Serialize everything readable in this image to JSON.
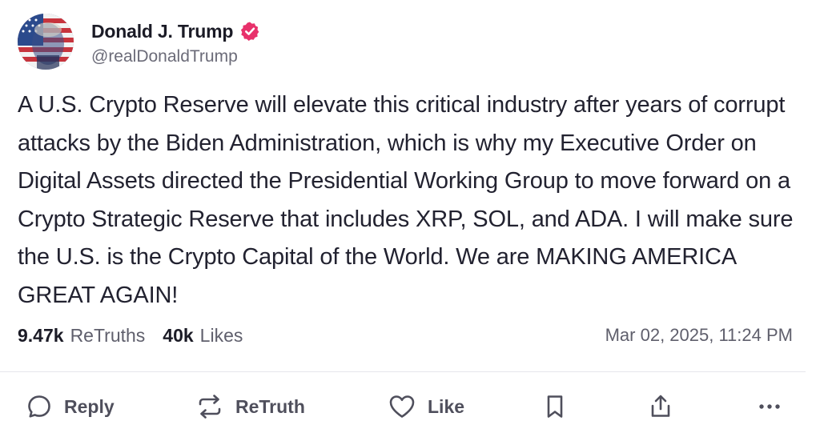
{
  "author": {
    "display_name": "Donald J. Trump",
    "handle": "@realDonaldTrump",
    "verified": true,
    "avatar_icon": "profile-photo-flag"
  },
  "post": {
    "text": "A U.S. Crypto Reserve will elevate this critical industry after years of corrupt attacks by the Biden Administration, which is why my Executive Order on Digital Assets directed the Presidential Working Group to move forward on a Crypto Strategic Reserve that includes XRP, SOL, and ADA. I will make sure the U.S. is the Crypto Capital of the World. We are MAKING AMERICA GREAT AGAIN!"
  },
  "stats": {
    "retruths_count": "9.47k",
    "retruths_label": "ReTruths",
    "likes_count": "40k",
    "likes_label": "Likes",
    "timestamp": "Mar 02, 2025, 11:24 PM"
  },
  "actions": {
    "reply_label": "Reply",
    "retruth_label": "ReTruth",
    "like_label": "Like",
    "icons": [
      "reply-icon",
      "retruth-icon",
      "like-icon",
      "bookmark-icon",
      "share-icon",
      "more-icon"
    ]
  },
  "colors": {
    "verified_badge": "#e8316b",
    "text_primary": "#1b1b26",
    "text_secondary": "#5f5f6c",
    "divider": "#e6e6ec"
  }
}
